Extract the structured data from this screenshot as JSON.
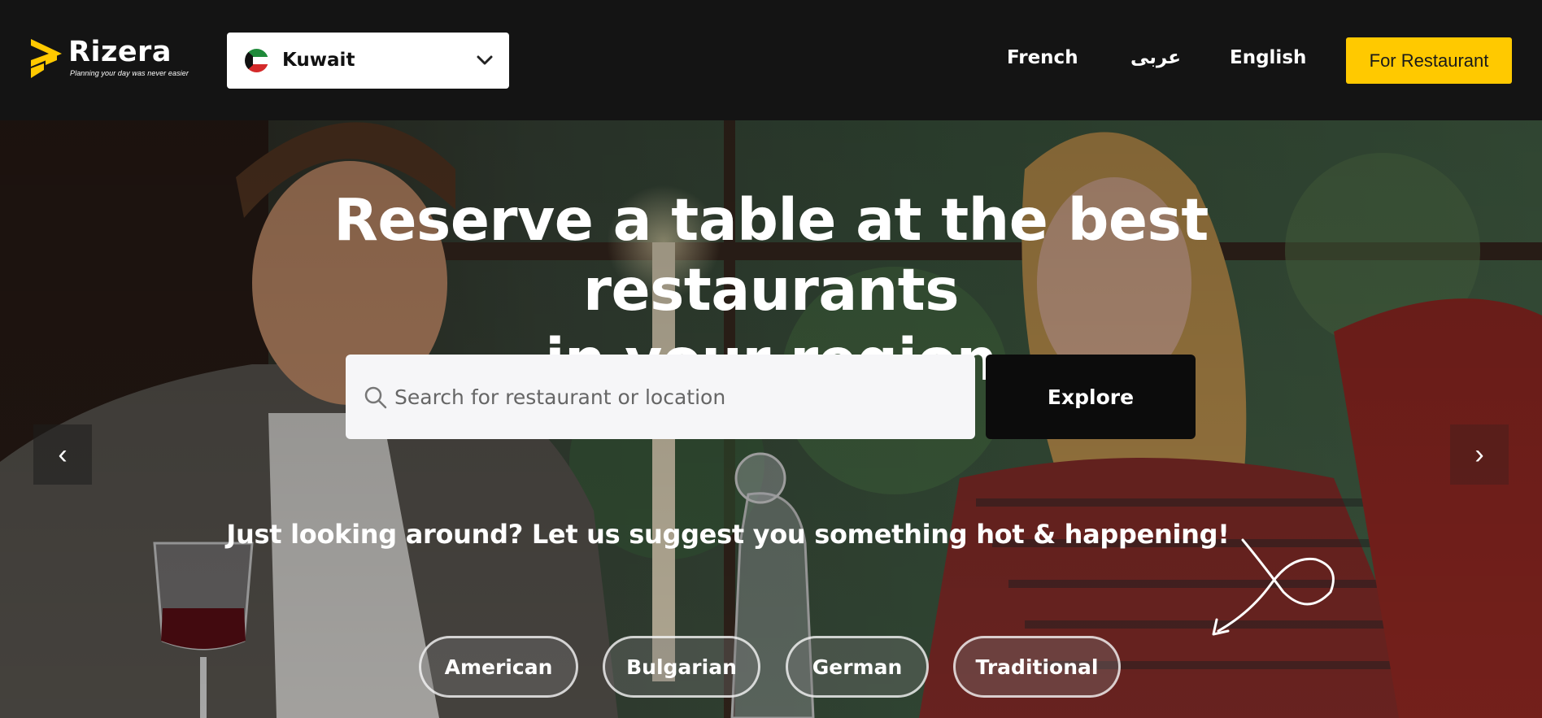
{
  "brand": {
    "name": "Rizera",
    "tagline": "Planning your day was never easier",
    "accent_color": "#ffc900"
  },
  "country_selector": {
    "selected": "Kuwait",
    "flag_icon": "kuwait-flag-icon"
  },
  "languages": [
    "French",
    "عربى",
    "English"
  ],
  "header": {
    "cta_label": "For Restaurant"
  },
  "hero": {
    "title_line1": "Reserve a table at the best restaurants",
    "title_line2": "in your region",
    "search_placeholder": "Search for restaurant or location",
    "explore_label": "Explore",
    "prev_label": "‹",
    "next_label": "›",
    "suggest_text": "Just looking around? Let us suggest you something hot & happening!",
    "cuisines": [
      "American",
      "Bulgarian",
      "German",
      "Traditional"
    ]
  }
}
